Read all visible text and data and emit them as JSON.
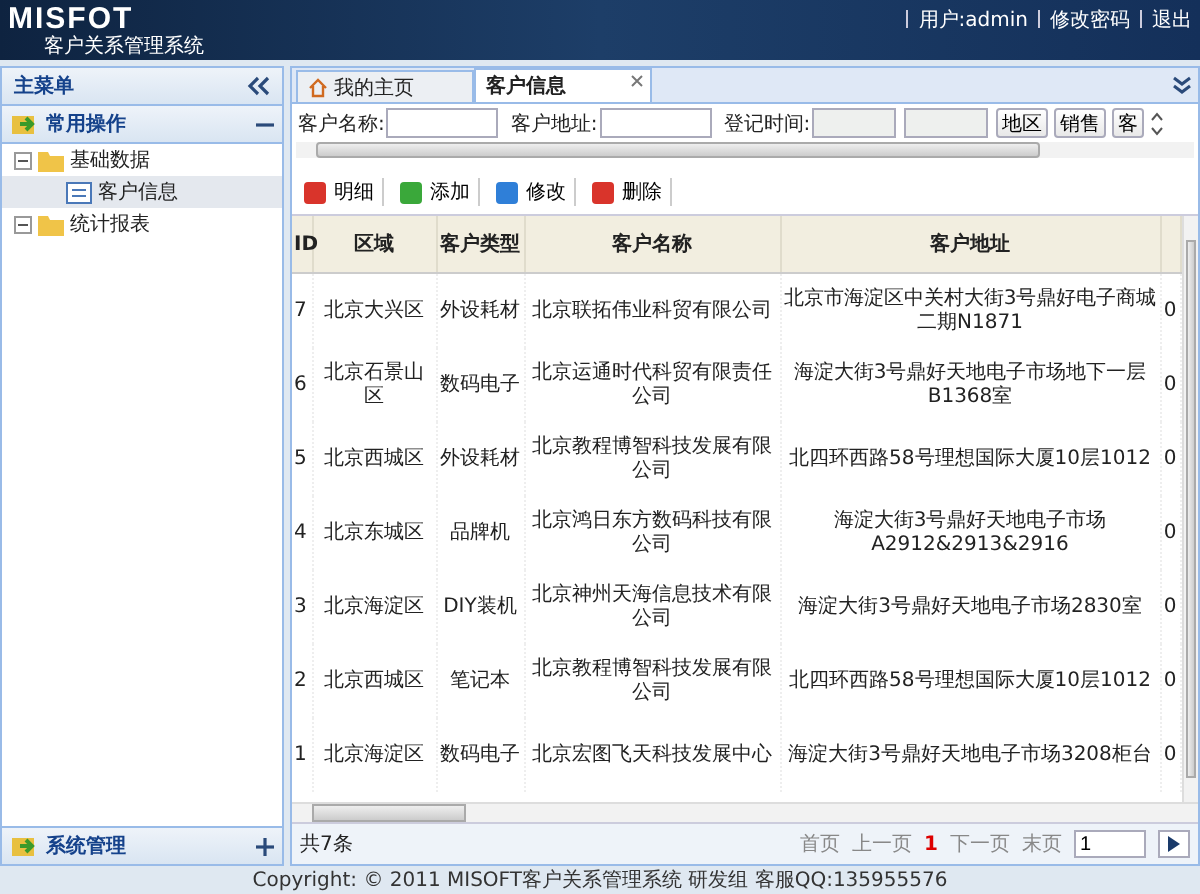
{
  "header": {
    "logo": "MISFOT",
    "subtitle": "客户关系管理系统",
    "links": [
      "用户:admin",
      "修改密码",
      "退出"
    ]
  },
  "sidebar": {
    "title": "主菜单",
    "groups": [
      {
        "label": "常用操作",
        "expanded": true,
        "tree": [
          {
            "label": "基础数据",
            "expanded": true,
            "children": [
              {
                "label": "客户信息",
                "selected": true
              }
            ]
          },
          {
            "label": "统计报表",
            "expanded": true
          }
        ]
      },
      {
        "label": "系统管理",
        "expanded": false
      }
    ]
  },
  "tabs": [
    {
      "label": "我的主页",
      "selected": false,
      "closable": false
    },
    {
      "label": "客户信息",
      "selected": true,
      "closable": true
    }
  ],
  "search": {
    "fields": [
      {
        "label": "客户名称:",
        "kind": "text"
      },
      {
        "label": "客户地址:",
        "kind": "text"
      },
      {
        "label": "登记时间:",
        "kind": "daterange"
      }
    ],
    "buttons": [
      "地区",
      "销售",
      "客"
    ]
  },
  "toolbar": [
    {
      "label": "明细",
      "color": "#d9342b"
    },
    {
      "label": "添加",
      "color": "#3aa83a"
    },
    {
      "label": "修改",
      "color": "#2f7fd8"
    },
    {
      "label": "删除",
      "color": "#d9342b"
    }
  ],
  "table": {
    "columns": [
      "ID",
      "区域",
      "客户类型",
      "客户名称",
      "客户地址"
    ],
    "rows": [
      [
        "7",
        "北京大兴区",
        "外设耗材",
        "北京联拓伟业科贸有限公司",
        "北京市海淀区中关村大街3号鼎好电子商城二期N1871",
        "0"
      ],
      [
        "6",
        "北京石景山区",
        "数码电子",
        "北京运通时代科贸有限责任公司",
        "海淀大街3号鼎好天地电子市场地下一层B1368室",
        "0"
      ],
      [
        "5",
        "北京西城区",
        "外设耗材",
        "北京教程博智科技发展有限公司",
        "北四环西路58号理想国际大厦10层1012",
        "0"
      ],
      [
        "4",
        "北京东城区",
        "品牌机",
        "北京鸿日东方数码科技有限公司",
        "海淀大街3号鼎好天地电子市场A2912&2913&2916",
        "0"
      ],
      [
        "3",
        "北京海淀区",
        "DIY装机",
        "北京神州天海信息技术有限公司",
        "海淀大街3号鼎好天地电子市场2830室",
        "0"
      ],
      [
        "2",
        "北京西城区",
        "笔记本",
        "北京教程博智科技发展有限公司",
        "北四环西路58号理想国际大厦10层1012",
        "0"
      ],
      [
        "1",
        "北京海淀区",
        "数码电子",
        "北京宏图飞天科技发展中心",
        "海淀大街3号鼎好天地电子市场3208柜台",
        "0"
      ]
    ]
  },
  "pager": {
    "total": "共7条",
    "first": "首页",
    "prev": "上一页",
    "page": "1",
    "next": "下一页",
    "last": "末页",
    "input": "1"
  },
  "footer": "Copyright: © 2011 MISOFT客户关系管理系统 研发组 客服QQ:135955576"
}
